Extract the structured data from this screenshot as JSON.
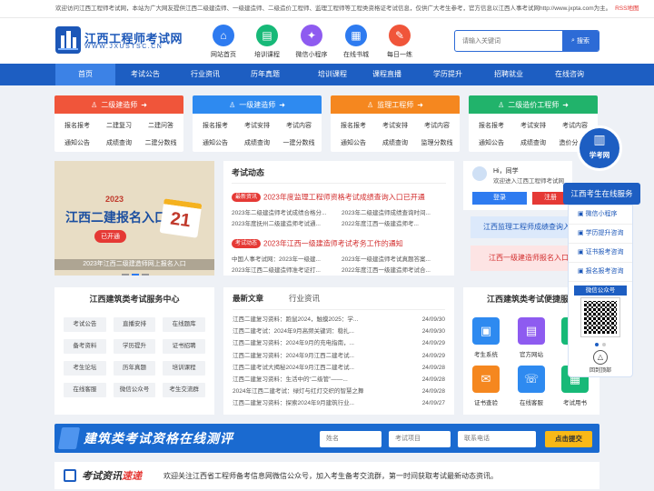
{
  "notice": {
    "text": "欢迎访问江西工程师考试网，本站为广大网友提供江西二级建造师、一级建造师、二级造价工程师、监理工程师等工程类资格证考试信息，仅供广大考生参考，官方信息以江西人事考试网http://www.jxpta.com为主。",
    "rss": "RSS地图"
  },
  "logo": {
    "title": "江西工程师考试网",
    "sub": "WWW.JXUSTSC.CN"
  },
  "quick": [
    {
      "label": "网站首页",
      "icon": "home-icon",
      "color": "#2e7bf0"
    },
    {
      "label": "培训课程",
      "icon": "course-icon",
      "color": "#17b978"
    },
    {
      "label": "微信小程序",
      "icon": "wechat-mini-icon",
      "color": "#8e5bf0"
    },
    {
      "label": "在线书城",
      "icon": "book-icon",
      "color": "#2e7bf0"
    },
    {
      "label": "每日一练",
      "icon": "practice-icon",
      "color": "#f0553a"
    }
  ],
  "search": {
    "placeholder": "请输入关键词",
    "button": "搜索"
  },
  "nav": [
    "首页",
    "考试公告",
    "行业资讯",
    "历年真题",
    "培训课程",
    "课程直播",
    "学历提升",
    "招聘就业",
    "在线咨询"
  ],
  "categories": [
    {
      "title": "二级建造师",
      "color": "#f0553a",
      "links": [
        "报名报考",
        "二建复习",
        "二建问答",
        "通知公告",
        "成绩查询",
        "二建分数线"
      ]
    },
    {
      "title": "一级建造师",
      "color": "#2e8af0",
      "links": [
        "报名报考",
        "考试安排",
        "考试内容",
        "通知公告",
        "成绩查询",
        "一建分数线"
      ]
    },
    {
      "title": "监理工程师",
      "color": "#f5871f",
      "links": [
        "报名报考",
        "考试安排",
        "考试内容",
        "通知公告",
        "成绩查询",
        "监理分数线"
      ]
    },
    {
      "title": "二级造价工程师",
      "color": "#21b36b",
      "links": [
        "报名报考",
        "考试安排",
        "考试内容",
        "通知公告",
        "成绩查询",
        "造价分数线"
      ]
    }
  ],
  "banner": {
    "year": "2023",
    "title": "江西二建报名入口",
    "badge": "已开通",
    "day": "21",
    "caption": "2023年江西二级建造师网上报名入口"
  },
  "exam_news": {
    "title": "考试动态",
    "groups": [
      {
        "tag": "最新资讯",
        "headline": "2023年度监理工程师资格考试成绩查询入口已开通",
        "links": [
          "2023年二级建造师考试成绩合格分...",
          "2023年二级建造师成绩查询时间...",
          "2023年度抚州二级建造师考试通...",
          "2022年度江西一级建造师考..."
        ]
      },
      {
        "tag": "考试动态",
        "headline": "2023年江西一级建造师考试考务工作的通知",
        "links": [
          "中国人事考试网：2023年一级建...",
          "2023年一级建造师考试真题答案...",
          "2023年江西二级建造师准考证打...",
          "2022年度江西一级建造师考试合..."
        ]
      }
    ]
  },
  "user": {
    "greeting": "Hi，同学",
    "welcome": "欢迎进入江西工程师考试网",
    "login": "登录",
    "register": "注册"
  },
  "promo": [
    "江西监理工程师成绩查询入口",
    "江西一级建造师报名入口"
  ],
  "services": {
    "title": "江西建筑类考试服务中心",
    "items": [
      "考试公告",
      "直播安排",
      "在线题库",
      "备考资料",
      "学历提升",
      "证书招聘",
      "考生论坛",
      "历年真题",
      "培训课程",
      "在线客服",
      "微信公众号",
      "考生交流群"
    ]
  },
  "articles": {
    "tabs": [
      "最新文章",
      "行业资讯"
    ],
    "items": [
      {
        "title": "江西二建复习资料：跑鼠2024，触摸2025：学...",
        "date": "24/09/30"
      },
      {
        "title": "江西二建考试：2024年9月高频关键词：稳扎...",
        "date": "24/09/30"
      },
      {
        "title": "江西二建复习资料：2024年9月的充电指南，...",
        "date": "24/09/29"
      },
      {
        "title": "江西二建复习资料：2024年9月江西二建考试...",
        "date": "24/09/29"
      },
      {
        "title": "江西二建考试大揭秘2024年9月江西二建考试...",
        "date": "24/09/28"
      },
      {
        "title": "江西二建复习资料：生活中的“二级管”——...",
        "date": "24/09/28"
      },
      {
        "title": "2024年江西二建考试：绿灯与红灯交织的智慧之舞",
        "date": "24/09/28"
      },
      {
        "title": "江西二建复习资料：探索2024年9月建筑行业...",
        "date": "24/09/27"
      }
    ]
  },
  "tools": {
    "title": "江西建筑类考试便捷服",
    "items": [
      {
        "label": "考生系统",
        "icon": "system-icon",
        "color": "#2e8af0"
      },
      {
        "label": "官方网站",
        "icon": "website-icon",
        "color": "#8e5bf0"
      },
      {
        "label": "APP",
        "icon": "app-icon",
        "color": "#17b978"
      },
      {
        "label": "证书查验",
        "icon": "certificate-icon",
        "color": "#f5871f"
      },
      {
        "label": "在线客服",
        "icon": "service-icon",
        "color": "#2e8af0"
      },
      {
        "label": "考试用书",
        "icon": "book-icon",
        "color": "#17b978"
      }
    ]
  },
  "float": {
    "brand": "学考网",
    "title": "江西考生在线服务",
    "links": [
      "微信小程序",
      "学历提升咨询",
      "证书报考咨询",
      "报名报考咨询"
    ],
    "qr_label": "微信公众号",
    "top": "回到顶部"
  },
  "eval": {
    "title": "建筑类考试资格在线测评",
    "name": "姓名",
    "item": "考试项目",
    "phone": "联系电话",
    "submit": "点击提交"
  },
  "express": {
    "title_a": "考试资讯",
    "title_b": "速递",
    "text": "欢迎关注江西省工程师备考信息网微信公众号，加入考生备考交流群，第一时间获取考试最新动态资讯。"
  }
}
